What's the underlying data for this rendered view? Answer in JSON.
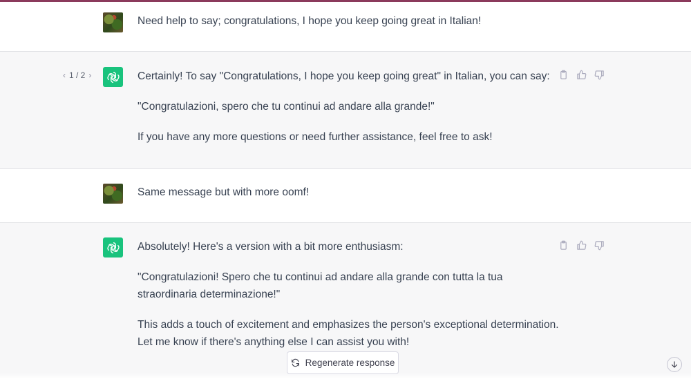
{
  "accent_bar_color": "#8b3a5c",
  "bot_avatar_color": "#19c37d",
  "conversation": [
    {
      "role": "user",
      "avatar": "user-avatar-image",
      "paragraphs": [
        "Need help to say; congratulations, I hope you keep going great in Italian!"
      ]
    },
    {
      "role": "assistant",
      "avatar": "openai-logo-icon",
      "pager": {
        "text": "1 / 2",
        "prev": "‹",
        "next": "›"
      },
      "paragraphs": [
        "Certainly! To say \"Congratulations, I hope you keep going great\" in Italian, you can say:",
        "\"Congratulazioni, spero che tu continui ad andare alla grande!\"",
        "If you have any more questions or need further assistance, feel free to ask!"
      ],
      "actions": [
        "clipboard-icon",
        "thumbs-up-icon",
        "thumbs-down-icon"
      ]
    },
    {
      "role": "user",
      "avatar": "user-avatar-image",
      "paragraphs": [
        "Same message but with more oomf!"
      ]
    },
    {
      "role": "assistant",
      "avatar": "openai-logo-icon",
      "paragraphs": [
        "Absolutely! Here's a version with a bit more enthusiasm:",
        "\"Congratulazioni! Spero che tu continui ad andare alla grande con tutta la tua straordinaria determinazione!\"",
        "This adds a touch of excitement and emphasizes the person's exceptional determination. Let me know if there's anything else I can assist you with!"
      ],
      "actions": [
        "clipboard-icon",
        "thumbs-up-icon",
        "thumbs-down-icon"
      ]
    }
  ],
  "regenerate": {
    "label": "Regenerate response",
    "icon": "refresh-icon"
  },
  "scroll_down": {
    "icon": "arrow-down-icon"
  }
}
